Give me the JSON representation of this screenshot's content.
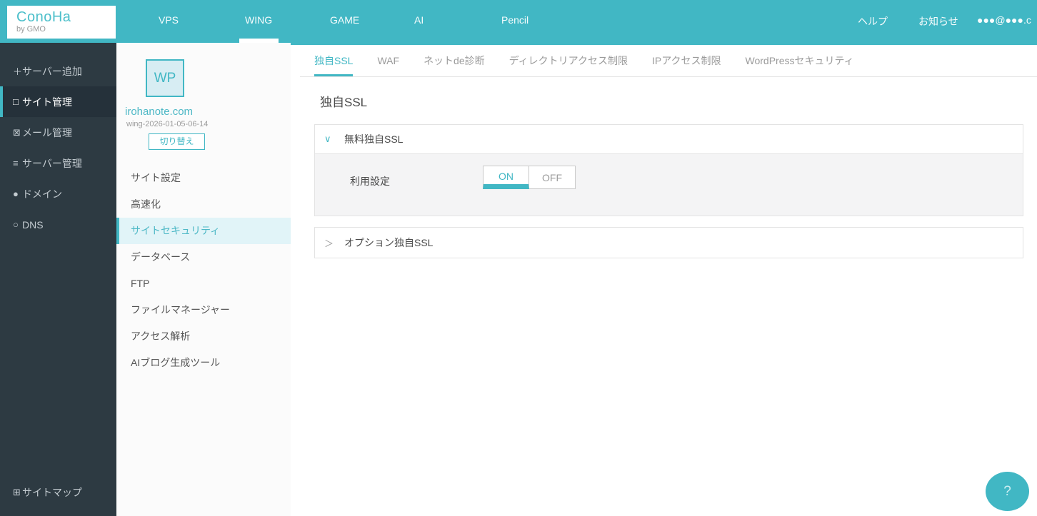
{
  "colors": {
    "accent": "#41b7c4",
    "header_bg": "#41b7c4",
    "sidebar_bg": "#2d3a42",
    "sidebar_active_bg": "#25313a",
    "panel_bg": "#fbfbfb",
    "panel_active_bg": "#e1f4f8",
    "accordion_body_bg": "#f4f4f5",
    "inactive_text": "#9b9b9b"
  },
  "header": {
    "logo": {
      "name": "ConoHa",
      "sub": "by GMO"
    },
    "nav": [
      {
        "label": "VPS",
        "active": false
      },
      {
        "label": "WING",
        "active": true
      },
      {
        "label": "GAME",
        "active": false
      },
      {
        "label": "AI",
        "active": false
      },
      {
        "label": "Pencil",
        "active": false
      }
    ],
    "help": "ヘルプ",
    "news": "お知らせ",
    "account": "●●●@●●●.c"
  },
  "sidebar": {
    "items": [
      {
        "icon": "plus-icon",
        "glyph": "＋",
        "label": "サーバー追加",
        "active": false
      },
      {
        "icon": "site-icon",
        "glyph": "□",
        "label": "サイト管理",
        "active": true
      },
      {
        "icon": "mail-icon",
        "glyph": "⊠",
        "label": "メール管理",
        "active": false
      },
      {
        "icon": "server-icon",
        "glyph": "≡",
        "label": "サーバー管理",
        "active": false
      },
      {
        "icon": "domain-icon",
        "glyph": "●",
        "label": "ドメイン",
        "active": false
      },
      {
        "icon": "dns-icon",
        "glyph": "○",
        "label": "DNS",
        "active": false
      }
    ],
    "footer": {
      "icon": "sitemap-icon",
      "glyph": "⊞",
      "label": "サイトマップ"
    }
  },
  "site_panel": {
    "badge": "WP",
    "domain": "irohanote.com",
    "server_name": "wing-2026-01-05-06-14",
    "switch_button": "切り替え",
    "menu": [
      {
        "label": "サイト設定",
        "active": false
      },
      {
        "label": "高速化",
        "active": false
      },
      {
        "label": "サイトセキュリティ",
        "active": true
      },
      {
        "label": "データベース",
        "active": false
      },
      {
        "label": "FTP",
        "active": false
      },
      {
        "label": "ファイルマネージャー",
        "active": false
      },
      {
        "label": "アクセス解析",
        "active": false
      },
      {
        "label": "AIブログ生成ツール",
        "active": false
      }
    ]
  },
  "main": {
    "tabs": [
      {
        "label": "独自SSL",
        "active": true
      },
      {
        "label": "WAF",
        "active": false
      },
      {
        "label": "ネットde診断",
        "active": false
      },
      {
        "label": "ディレクトリアクセス制限",
        "active": false
      },
      {
        "label": "IPアクセス制限",
        "active": false
      },
      {
        "label": "WordPressセキュリティ",
        "active": false
      }
    ],
    "page_title": "独自SSL",
    "free_ssl": {
      "chevron": "∨",
      "title": "無料独自SSL",
      "expanded": true,
      "usage_label": "利用設定",
      "toggle": {
        "on_label": "ON",
        "off_label": "OFF",
        "value": "ON"
      }
    },
    "option_ssl": {
      "chevron": "＞",
      "title": "オプション独自SSL",
      "expanded": false
    },
    "help_button": "?"
  }
}
